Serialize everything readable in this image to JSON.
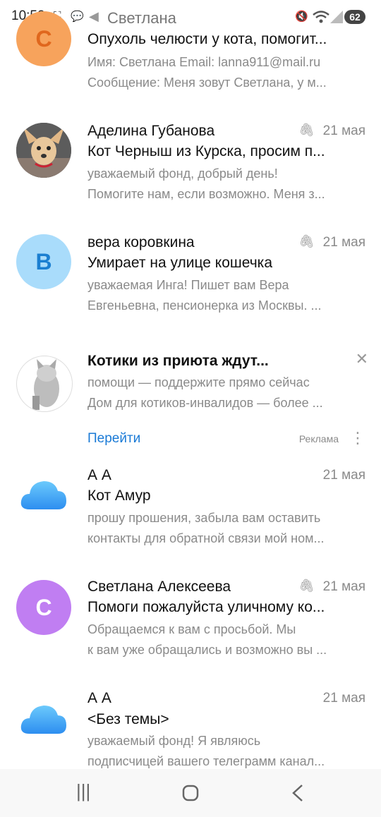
{
  "status_bar": {
    "time": "10:52",
    "back_name": "Светлана",
    "battery": "62"
  },
  "emails": [
    {
      "avatar_letter": "С",
      "avatar_color": "#f7a35c",
      "subject": "Опухоль челюсти у кота, помогит...",
      "preview1": "Имя: Светлана Email: lanna911@mail.ru",
      "preview2": "Сообщение: Меня зовут Светлана, у м..."
    },
    {
      "sender": "Аделина Губанова",
      "date": "21 мая",
      "subject": "Кот Черныш из Курска, просим п...",
      "preview1": "уважаемый фонд, добрый день!",
      "preview2": "Помогите нам, если возможно. Меня з..."
    },
    {
      "avatar_letter": "В",
      "avatar_color": "#a9dcfb",
      "sender": "вера коровкина",
      "date": "21 мая",
      "subject": "Умирает на улице кошечка",
      "preview1": "уважаемая Инга! Пишет вам Вера",
      "preview2": "Евгеньевна, пенсионерка из Москвы. ..."
    },
    {
      "sender": "А А",
      "date": "21 мая",
      "subject": "Кот Амур",
      "preview1": "прошу прошения, забыла вам оставить",
      "preview2": "контакты для обратной связи мой ном..."
    },
    {
      "avatar_letter": "С",
      "avatar_color": "#c07ef2",
      "sender": "Светлана Алексеева",
      "date": "21 мая",
      "subject": "Помоги пожалуйста уличному ко...",
      "preview1": "Обращаемся к вам с просьбой. Мы",
      "preview2": "к вам уже обращались и возможно вы ..."
    },
    {
      "sender": "А А",
      "date": "21 мая",
      "subject": "<Без темы>",
      "preview1": "уважаемый фонд! Я являюсь",
      "preview2": "подписчицей вашего телеграмм канал..."
    }
  ],
  "ad": {
    "title": "Котики из приюта ждут...",
    "text1": "помощи — поддержите прямо сейчас",
    "text2": "Дом для котиков-инвалидов — более ...",
    "go": "Перейти",
    "label": "Реклама"
  }
}
